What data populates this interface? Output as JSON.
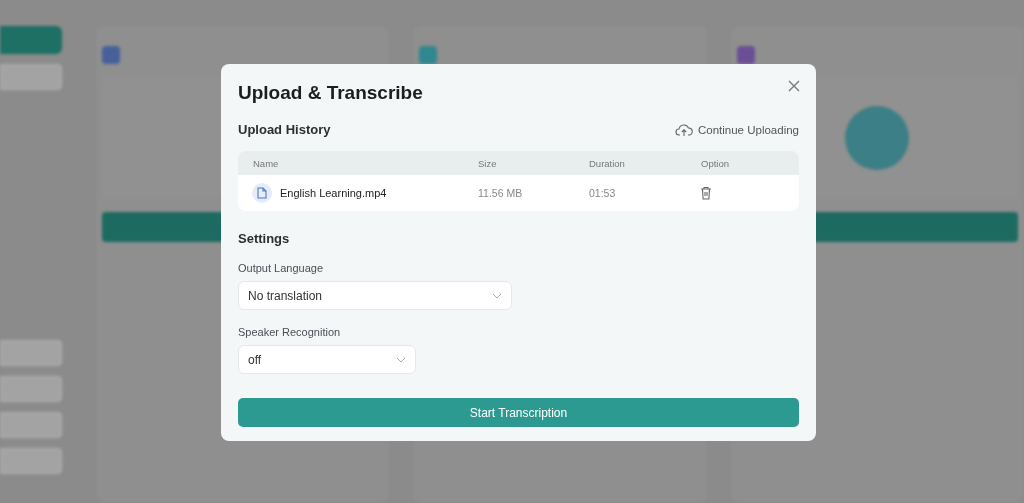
{
  "dialog": {
    "title": "Upload & Transcribe",
    "upload_history": {
      "title": "Upload History",
      "continue_button": "Continue Uploading",
      "columns": [
        "Name",
        "Size",
        "Duration",
        "Option"
      ],
      "rows": [
        {
          "name": "English Learning.mp4",
          "size": "11.56 MB",
          "duration": "01:53"
        }
      ]
    },
    "settings": {
      "title": "Settings",
      "fields": [
        {
          "label": "Output Language",
          "value": "No translation"
        },
        {
          "label": "Speaker Recognition",
          "value": "off"
        }
      ]
    },
    "start_button": "Start Transcription"
  }
}
